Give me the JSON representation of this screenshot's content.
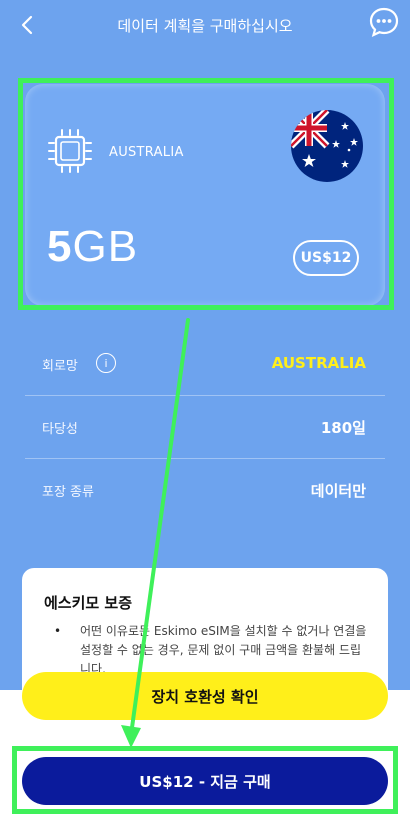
{
  "header": {
    "title": "데이터 계획을 구매하십시오",
    "back_icon": "chevron-left-icon",
    "chat_icon": "chat-bubble-icon"
  },
  "plan_card": {
    "chip_icon": "sim-chip-icon",
    "country": "AUSTRALIA",
    "flag_icon": "australia-flag-icon",
    "data_number": "5",
    "data_unit": "GB",
    "price": "US$12"
  },
  "details": {
    "network_label": "회로망",
    "network_info_icon": "i",
    "network_value": "AUSTRALIA",
    "validity_label": "타당성",
    "validity_value": "180일",
    "package_label": "포장 종류",
    "package_value": "데이터만"
  },
  "guarantee": {
    "title": "에스키모 보증",
    "bullet": "•",
    "text": "어떤 이유로든 Eskimo eSIM을 설치할 수 없거나 연결을 설정할 수 없는 경우, 문제 없이 구매 금액을 환불해 드립니다."
  },
  "actions": {
    "compat_label": "장치 호환성 확인",
    "buy_label": "US$12 - 지금 구매"
  },
  "colors": {
    "background": "#6da3ee",
    "accent_yellow": "#ffef1a",
    "buy_button": "#0b1b9c",
    "annotation_green": "#3ff05a"
  }
}
